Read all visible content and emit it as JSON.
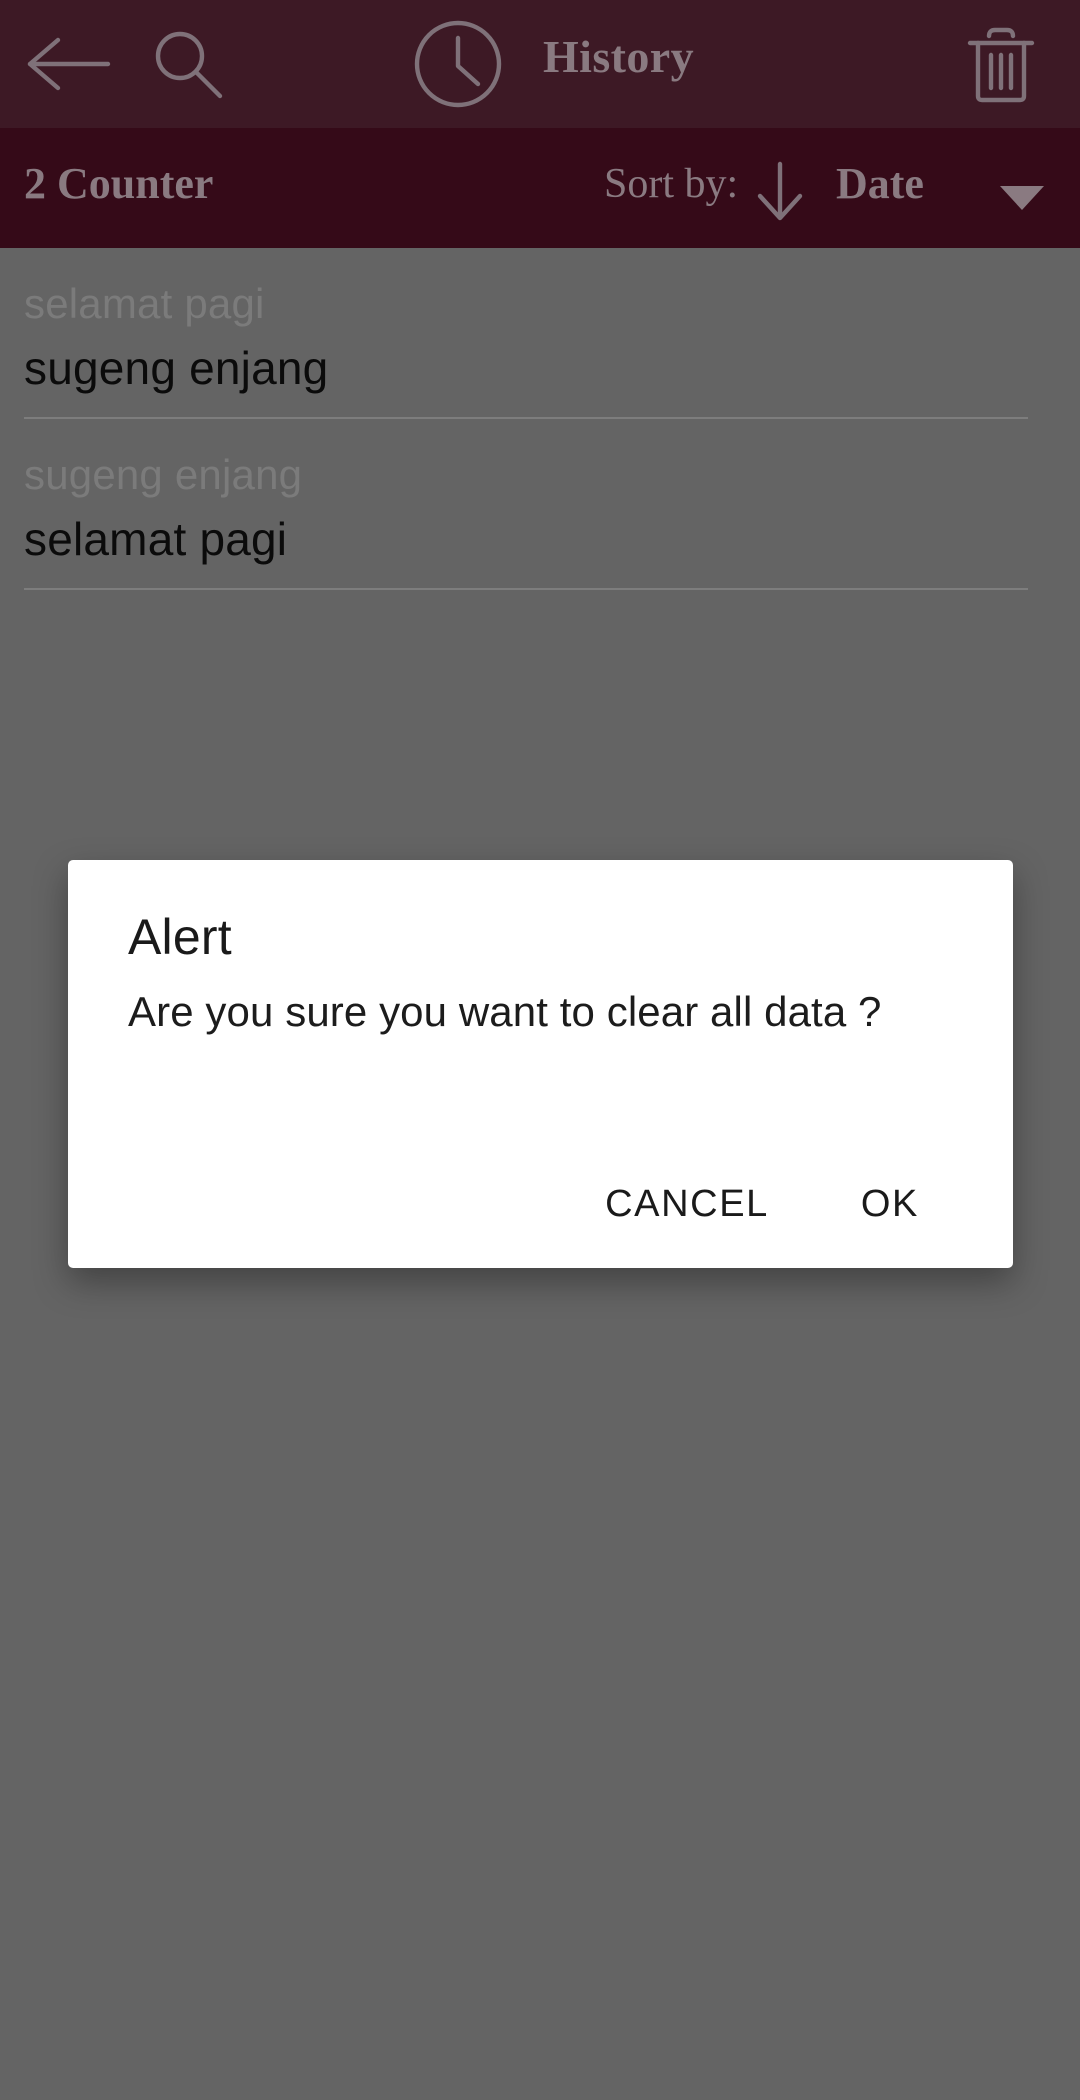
{
  "appbar": {
    "title": "History",
    "back_icon": "arrow-left-icon",
    "search_icon": "search-icon",
    "clock_icon": "clock-icon",
    "delete_icon": "trash-icon",
    "background_color": "#330a17",
    "foreground_color": "#8a7a81"
  },
  "sortbar": {
    "counter_label": "2 Counter",
    "sort_by_label": "Sort by:",
    "sort_direction_icon": "arrow-down-icon",
    "sort_field": "Date",
    "caret_icon": "caret-down-icon",
    "background_color": "#3b0c1b"
  },
  "history": {
    "items": [
      {
        "source": "selamat pagi",
        "translation": "sugeng enjang"
      },
      {
        "source": "sugeng enjang",
        "translation": "selamat pagi"
      }
    ]
  },
  "dialog": {
    "title": "Alert",
    "message": "Are you sure you want to clear all data ?",
    "cancel_label": "CANCEL",
    "ok_label": "OK",
    "background_color": "#ffffff",
    "scrim_color": "#646464"
  }
}
